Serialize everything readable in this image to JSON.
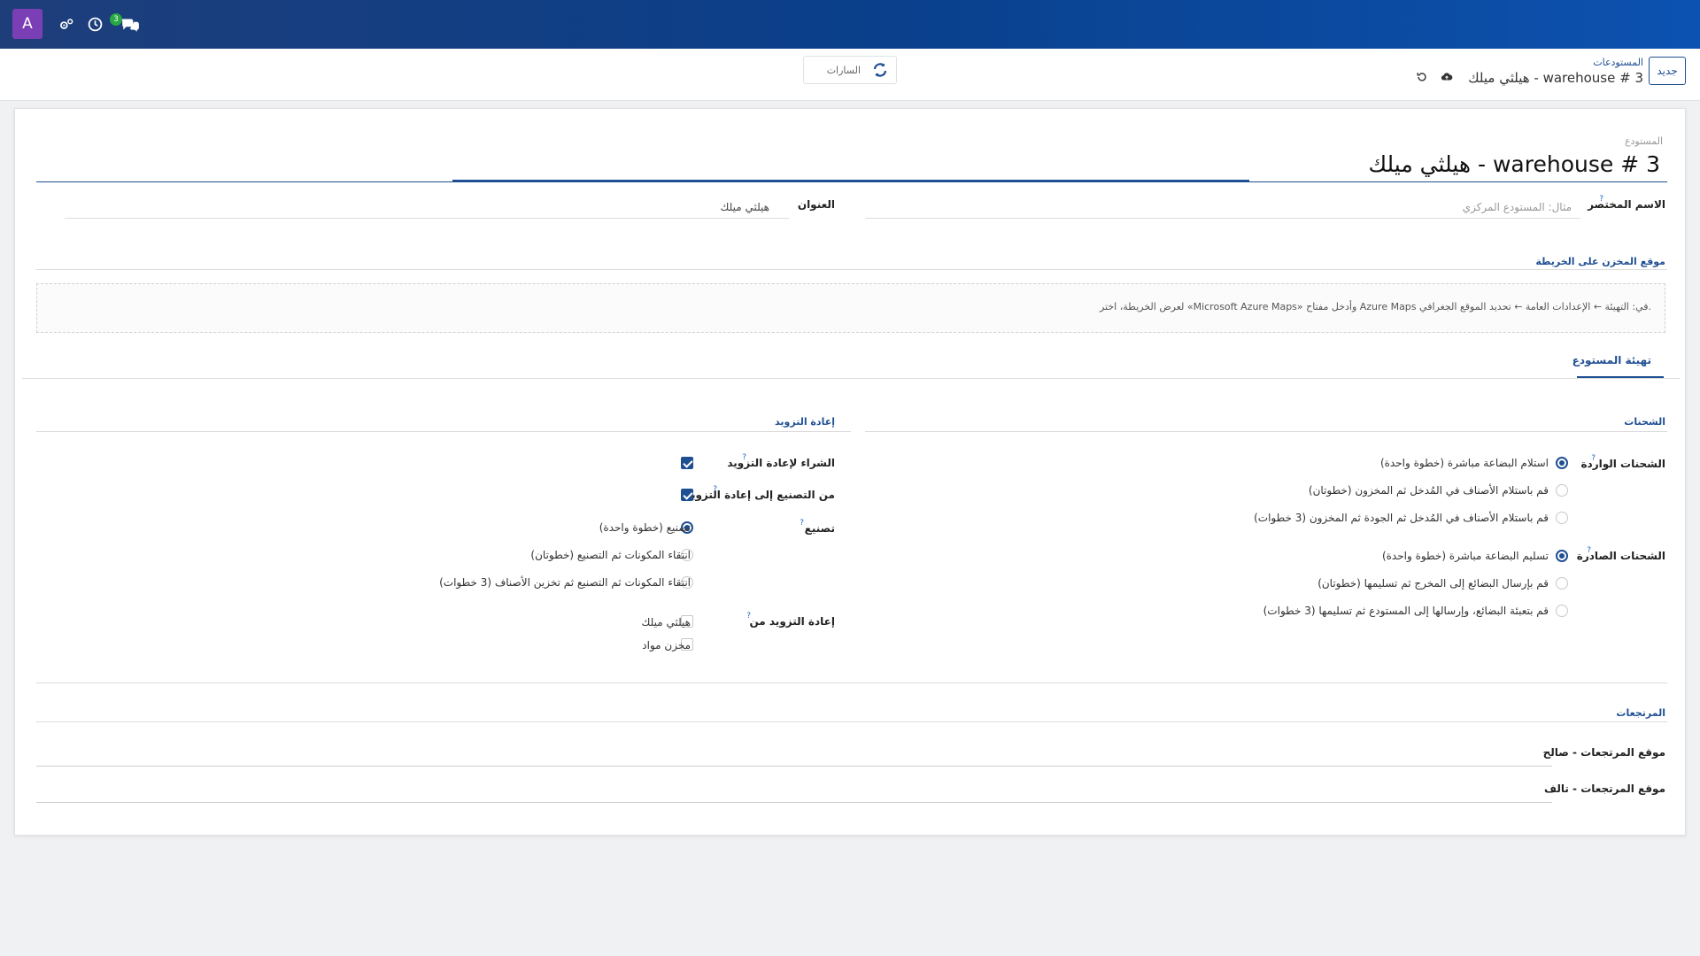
{
  "navbar": {
    "avatar_letter": "A",
    "messages_count": "3",
    "icons": [
      "settings-users-icon",
      "clock-icon",
      "messages-icon"
    ]
  },
  "control_panel": {
    "new_button": "جديد",
    "breadcrumb_parent": "المستودعات",
    "breadcrumb_current": "هيلثي ميلك - warehouse # 3",
    "sync_label": "السارات"
  },
  "form": {
    "warehouse_label": "المستودع",
    "warehouse_name": "هيلثي ميلك - warehouse # 3",
    "short_name_label": "الاسم المختصر",
    "short_name_placeholder": "مثال: المستودع المركزي",
    "address_label": "العنوان",
    "address_value": "هيلثي ميلك",
    "map_heading": "موقع المخزن على الخريطة",
    "map_message": "لعرض الخريطة، اختر «Microsoft Azure Maps» وأدخل مفتاح Azure Maps في: التهيئة ← الإعدادات العامة ← تحديد الموقع الجغرافي."
  },
  "tabs": {
    "warehouse_config": "تهيئة المستودع"
  },
  "shipments": {
    "heading": "الشحنات",
    "incoming_label": "الشحنات الواردة",
    "incoming_options": [
      "استلام البضاعة مباشرة (خطوة واحدة)",
      "قم باستلام الأصناف في المُدخل ثم المخزون (خطوتان)",
      "قم باستلام الأصناف في المُدخل ثم الجودة ثم المخزون (3 خطوات)"
    ],
    "outgoing_label": "الشحنات الصادرة",
    "outgoing_options": [
      "تسليم البضاعة مباشرة (خطوة واحدة)",
      "قم بإرسال البضائع إلى المخرج ثم تسليمها (خطوتان)",
      "قم بتعبئة البضائع، وإرسالها إلى المستودع ثم تسليمها (3 خطوات)"
    ]
  },
  "resupply": {
    "heading": "إعادة التزويد",
    "buy_label": "الشراء لإعادة التزويد",
    "buy_checked": true,
    "manufacture_resupply_label": "من التصنيع إلى إعادة التزويد",
    "manufacture_resupply_checked": true,
    "manufacture_label": "تصنيع",
    "manufacture_options": [
      "تصنيع (خطوة واحدة)",
      "انتقاء المكونات ثم التصنيع (خطوتان)",
      "انتقاء المكونات ثم التصنيع ثم تخزين الأصناف (3 خطوات)"
    ],
    "resupply_from_label": "إعادة التزويد من",
    "resupply_from_options": [
      "هيلثي ميلك",
      "مخزن مواد"
    ]
  },
  "returns": {
    "heading": "المرتجعات",
    "good_label": "موقع المرتجعات - صالح",
    "damaged_label": "موقع المرتجعات - تالف"
  },
  "colors": {
    "primary": "#1f4f93",
    "navbar": "#0a3f8a",
    "avatar": "#7b3fb5",
    "badge": "#28a745"
  }
}
